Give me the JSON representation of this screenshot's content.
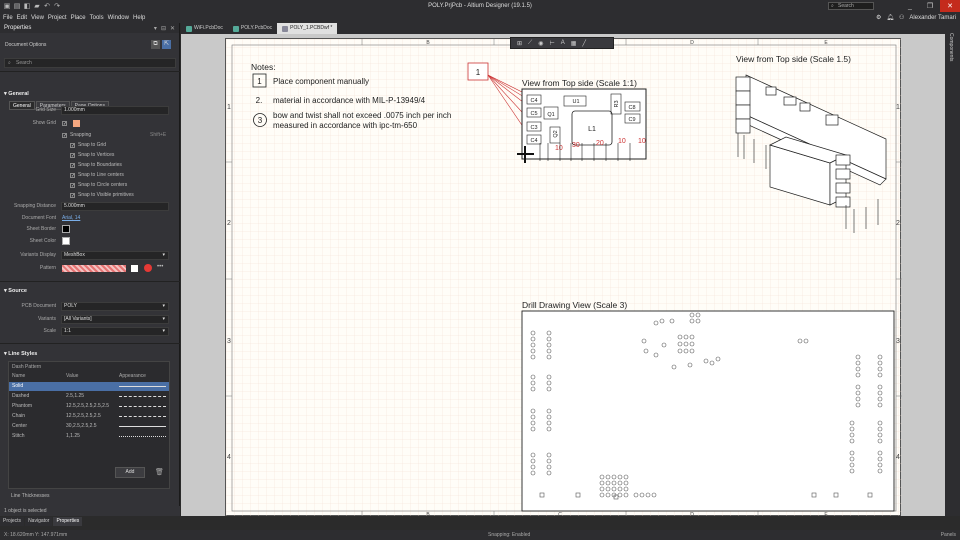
{
  "app": {
    "title": "POLY.PrjPcb - Altium Designer (19.1.5)",
    "search_placeholder": "Search",
    "user": "Alexander Tamari",
    "menu": [
      "File",
      "Edit",
      "View",
      "Project",
      "Place",
      "Tools",
      "Window",
      "Help"
    ]
  },
  "properties": {
    "title": "Properties",
    "subtitle": "Document Options",
    "search_placeholder": "Search",
    "tabs": [
      "General",
      "Parameters",
      "Page Options"
    ],
    "general": {
      "header": "General",
      "grid_size_label": "Grid Size",
      "grid_size": "1.000mm",
      "show_grid_label": "Show Grid",
      "snapping_label": "Snapping",
      "snapping_hint": "Shift+E",
      "snap_items": [
        "Snap to Grid",
        "Snap to Vertices",
        "Snap to Boundaries",
        "Snap to Line centers",
        "Snap to Circle centers",
        "Snap to Visible primitives"
      ],
      "snapping_distance_label": "Snapping Distance",
      "snapping_distance": "5.000mm",
      "doc_font_label": "Document Font",
      "doc_font": "Arial, 14",
      "sheet_border_label": "Sheet Border",
      "sheet_color_label": "Sheet Color",
      "variants_display_label": "Variants Display",
      "variants_display": "MeshBox",
      "pattern_label": "Pattern"
    },
    "source": {
      "header": "Source",
      "pcb_doc_label": "PCB Document",
      "pcb_doc": "POLY",
      "variants_label": "Variants",
      "variants": "[All Variants]",
      "scale_label": "Scale",
      "scale": "1:1"
    },
    "line_styles": {
      "header": "Line Styles",
      "dash_pattern": "Dash Pattern",
      "columns": [
        "Name",
        "Value",
        "Appearance"
      ],
      "rows": [
        {
          "name": "Solid",
          "value": ""
        },
        {
          "name": "Dashed",
          "value": "2.5,1.25"
        },
        {
          "name": "Phantom",
          "value": "12.5,2.5,2.5,2.5,2.5"
        },
        {
          "name": "Chain",
          "value": "12.5,2.5,2.5,2.5"
        },
        {
          "name": "Center",
          "value": "30,2.5,2.5,2.5"
        },
        {
          "name": "Stitch",
          "value": "1,1.25"
        }
      ],
      "add_label": "Add",
      "line_thickness": "Line Thicknesses"
    },
    "selection_info": "1 object is selected",
    "bottom_tabs": [
      "Projects",
      "Navigator",
      "Properties"
    ]
  },
  "doc_tabs": [
    {
      "label": "WiFi.PcbDoc",
      "active": false
    },
    {
      "label": "POLY.PcbDoc",
      "active": false
    },
    {
      "label": "POLY_1.PCBDwf *",
      "active": true
    }
  ],
  "drawing": {
    "notes_title": "Notes:",
    "notes": [
      {
        "num": "1",
        "text": "Place component manually",
        "shape": "box"
      },
      {
        "num": "2.",
        "text": "material in accordance with MIL-P-13949/4",
        "shape": "none"
      },
      {
        "num": "3",
        "text": "bow and twist shall not exceed .0075 inch per inch",
        "text2": "measured in accordance with ipc-tm-650",
        "shape": "circle"
      }
    ],
    "callout": "1",
    "top_view_title": "View from Top side (Scale 1:1)",
    "iso_view_title": "View from Top side (Scale 1.5)",
    "drill_view_title": "Drill Drawing View (Scale 3)",
    "col_labels": [
      "B",
      "C",
      "D",
      "E"
    ],
    "row_labels": [
      "1",
      "2",
      "3",
      "4"
    ],
    "refdes": [
      "C4",
      "C5",
      "C3",
      "C4",
      "Q1",
      "U1",
      "R3",
      "C8",
      "C9",
      "Q2",
      "L1"
    ],
    "dims": [
      "10",
      "30",
      "20",
      "10",
      "10"
    ]
  },
  "status": {
    "coords": "X: 18.620mm Y: 147.971mm",
    "snapping": "Snapping: Enabled",
    "panels": "Panels"
  },
  "right_panel": "Components",
  "colors": {
    "accent": "#4a6fa5",
    "close": "#c42b1c",
    "pattern": "#e57373",
    "red_dot": "#e53935"
  }
}
